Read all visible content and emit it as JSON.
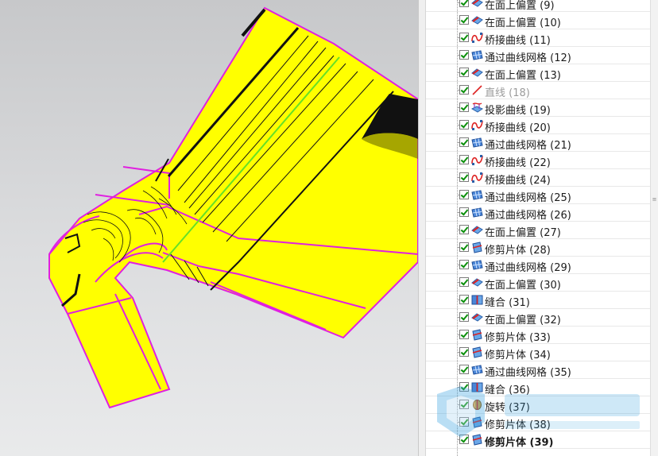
{
  "tree": {
    "items": [
      {
        "label": "在面上偏置 (9)",
        "icon": "offset-on-face-icon",
        "state": "normal"
      },
      {
        "label": "在面上偏置 (10)",
        "icon": "offset-on-face-icon",
        "state": "normal"
      },
      {
        "label": "桥接曲线 (11)",
        "icon": "bridge-curve-icon",
        "state": "normal"
      },
      {
        "label": "通过曲线网格 (12)",
        "icon": "curve-mesh-icon",
        "state": "normal"
      },
      {
        "label": "在面上偏置 (13)",
        "icon": "offset-on-face-icon",
        "state": "normal"
      },
      {
        "label": "直线 (18)",
        "icon": "line-icon",
        "state": "dim"
      },
      {
        "label": "投影曲线 (19)",
        "icon": "project-curve-icon",
        "state": "normal"
      },
      {
        "label": "桥接曲线 (20)",
        "icon": "bridge-curve-icon",
        "state": "normal"
      },
      {
        "label": "通过曲线网格 (21)",
        "icon": "curve-mesh-icon",
        "state": "normal"
      },
      {
        "label": "桥接曲线 (22)",
        "icon": "bridge-curve-icon",
        "state": "normal"
      },
      {
        "label": "桥接曲线 (24)",
        "icon": "bridge-curve-icon",
        "state": "normal"
      },
      {
        "label": "通过曲线网格 (25)",
        "icon": "curve-mesh-icon",
        "state": "normal"
      },
      {
        "label": "通过曲线网格 (26)",
        "icon": "curve-mesh-icon",
        "state": "normal"
      },
      {
        "label": "在面上偏置 (27)",
        "icon": "offset-on-face-icon",
        "state": "normal"
      },
      {
        "label": "修剪片体 (28)",
        "icon": "trim-sheet-icon",
        "state": "normal"
      },
      {
        "label": "通过曲线网格 (29)",
        "icon": "curve-mesh-icon",
        "state": "normal"
      },
      {
        "label": "在面上偏置 (30)",
        "icon": "offset-on-face-icon",
        "state": "normal"
      },
      {
        "label": "缝合 (31)",
        "icon": "sew-icon",
        "state": "normal"
      },
      {
        "label": "在面上偏置 (32)",
        "icon": "offset-on-face-icon",
        "state": "normal"
      },
      {
        "label": "修剪片体 (33)",
        "icon": "trim-sheet-icon",
        "state": "normal"
      },
      {
        "label": "修剪片体 (34)",
        "icon": "trim-sheet-icon",
        "state": "normal"
      },
      {
        "label": "通过曲线网格 (35)",
        "icon": "curve-mesh-icon",
        "state": "normal"
      },
      {
        "label": "缝合 (36)",
        "icon": "sew-icon",
        "state": "normal"
      },
      {
        "label": "旋转 (37)",
        "icon": "revolve-icon",
        "state": "normal"
      },
      {
        "label": "修剪片体 (38)",
        "icon": "trim-sheet-icon",
        "state": "normal"
      },
      {
        "label": "修剪片体 (39)",
        "icon": "trim-sheet-icon",
        "state": "current"
      }
    ]
  },
  "colors": {
    "surface": "#ffff00",
    "edge": "#e020e0",
    "highlight": "#66e028",
    "check": "#0a8f0a"
  }
}
